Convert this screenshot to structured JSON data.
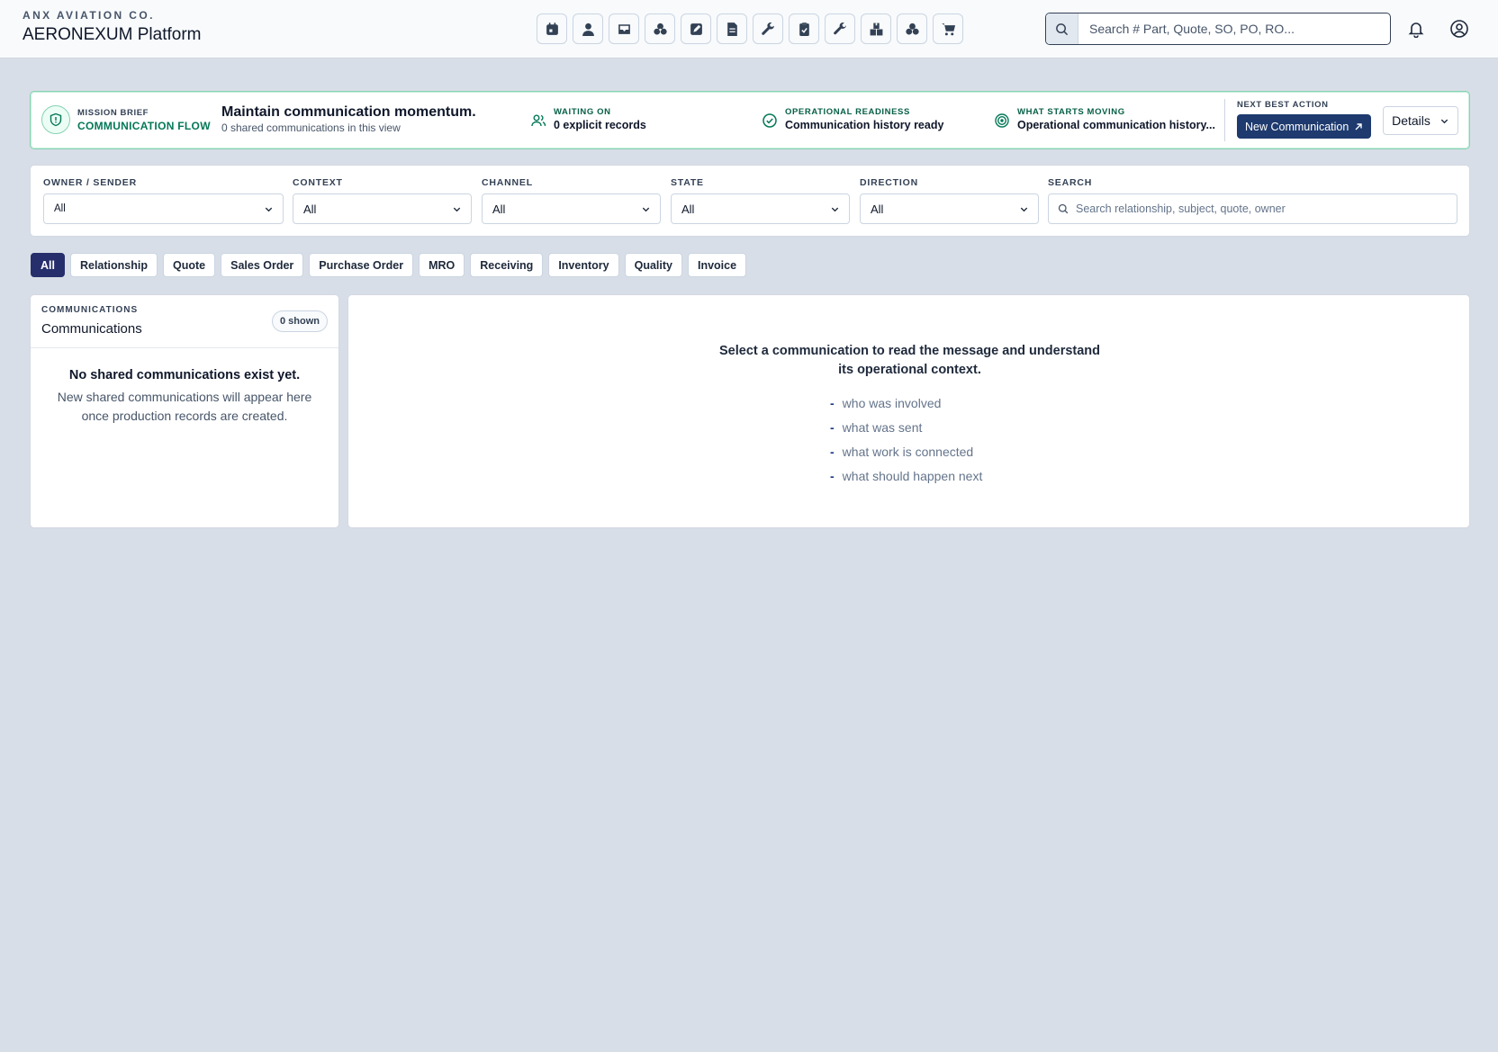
{
  "header": {
    "company": "ANX AVIATION CO.",
    "platform": "AERONEXUM Platform",
    "toolbar_icons": [
      "calendar-icon",
      "user-icon",
      "inbox-icon",
      "parts-icon",
      "edit-icon",
      "document-icon",
      "wrench-icon",
      "clipboard-icon",
      "tool-icon",
      "boxes-icon",
      "assembly-icon",
      "cart-icon"
    ],
    "search_placeholder": "Search # Part, Quote, SO, PO, RO..."
  },
  "brief": {
    "eyebrow": "MISSION BRIEF",
    "tag": "COMMUNICATION FLOW",
    "headline": "Maintain communication momentum.",
    "subline": "0 shared communications in this view",
    "waiting_label": "WAITING ON",
    "waiting_value": "0 explicit records",
    "readiness_label": "OPERATIONAL READINESS",
    "readiness_value": "Communication history ready",
    "moving_label": "WHAT STARTS MOVING",
    "moving_value": "Operational communication history...",
    "nba_label": "NEXT BEST ACTION",
    "nba_button": "New Communication",
    "details_button": "Details",
    "accent": "#047857"
  },
  "filters": {
    "owner_label": "OWNER / SENDER",
    "owner_value": "All",
    "context_label": "CONTEXT",
    "context_value": "All",
    "channel_label": "CHANNEL",
    "channel_value": "All",
    "state_label": "STATE",
    "state_value": "All",
    "direction_label": "DIRECTION",
    "direction_value": "All",
    "search_label": "SEARCH",
    "search_placeholder": "Search relationship, subject, quote, owner"
  },
  "chips": [
    "All",
    "Relationship",
    "Quote",
    "Sales Order",
    "Purchase Order",
    "MRO",
    "Receiving",
    "Inventory",
    "Quality",
    "Invoice"
  ],
  "active_chip": "All",
  "list": {
    "eyebrow": "COMMUNICATIONS",
    "title": "Communications",
    "count": "0 shown",
    "empty_title": "No shared communications exist yet.",
    "empty_desc": "New shared communications will appear here once production records are created."
  },
  "detail": {
    "prompt": "Select a communication to read the message and understand its operational context.",
    "bullets": [
      "who was involved",
      "what was sent",
      "what work is connected",
      "what should happen next"
    ]
  }
}
